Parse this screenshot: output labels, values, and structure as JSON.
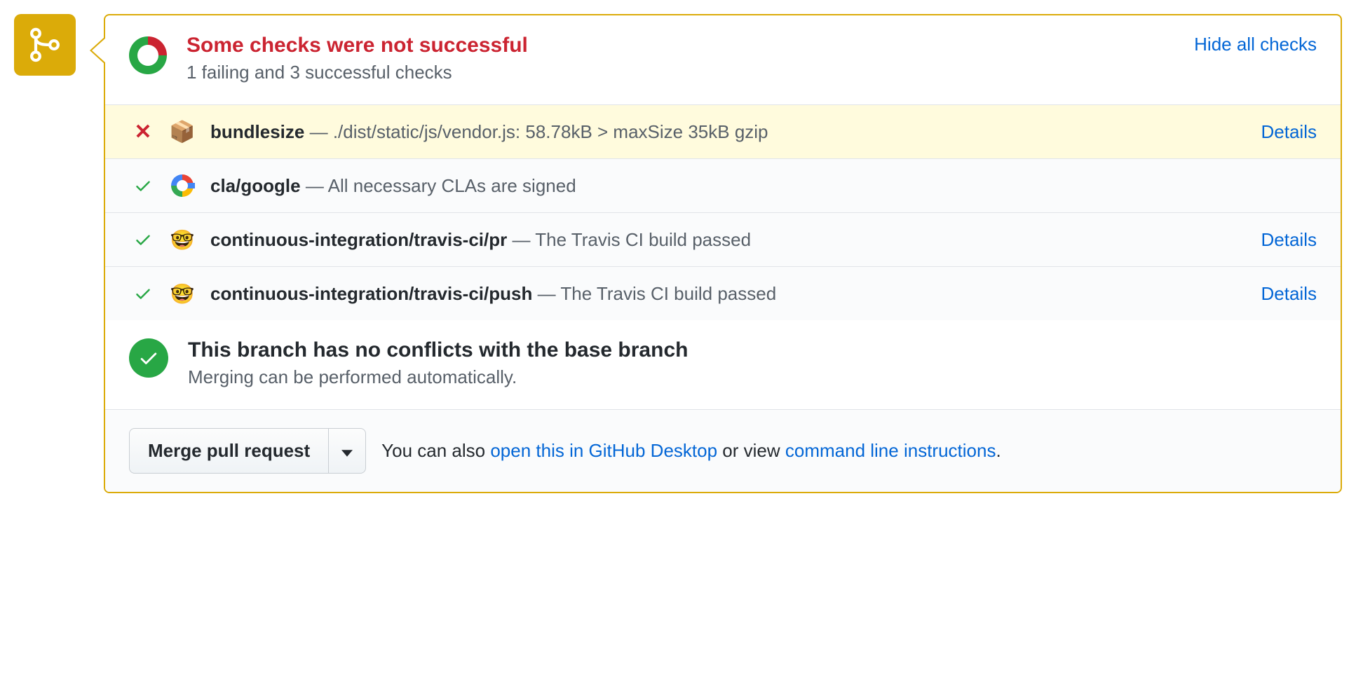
{
  "header": {
    "title": "Some checks were not successful",
    "subtitle": "1 failing and 3 successful checks",
    "hide_label": "Hide all checks"
  },
  "checks": [
    {
      "status": "fail",
      "icon": "package",
      "name": "bundlesize",
      "desc": "./dist/static/js/vendor.js: 58.78kB > maxSize 35kB gzip",
      "details": "Details"
    },
    {
      "status": "pass",
      "icon": "google",
      "name": "cla/google",
      "desc": "All necessary CLAs are signed",
      "details": ""
    },
    {
      "status": "pass",
      "icon": "travis",
      "name": "continuous-integration/travis-ci/pr",
      "desc": "The Travis CI build passed",
      "details": "Details"
    },
    {
      "status": "pass",
      "icon": "travis",
      "name": "continuous-integration/travis-ci/push",
      "desc": "The Travis CI build passed",
      "details": "Details"
    }
  ],
  "merge": {
    "title": "This branch has no conflicts with the base branch",
    "subtitle": "Merging can be performed automatically."
  },
  "footer": {
    "button": "Merge pull request",
    "pre": "You can also ",
    "link1": "open this in GitHub Desktop",
    "mid": " or view ",
    "link2": "command line instructions",
    "post": "."
  }
}
